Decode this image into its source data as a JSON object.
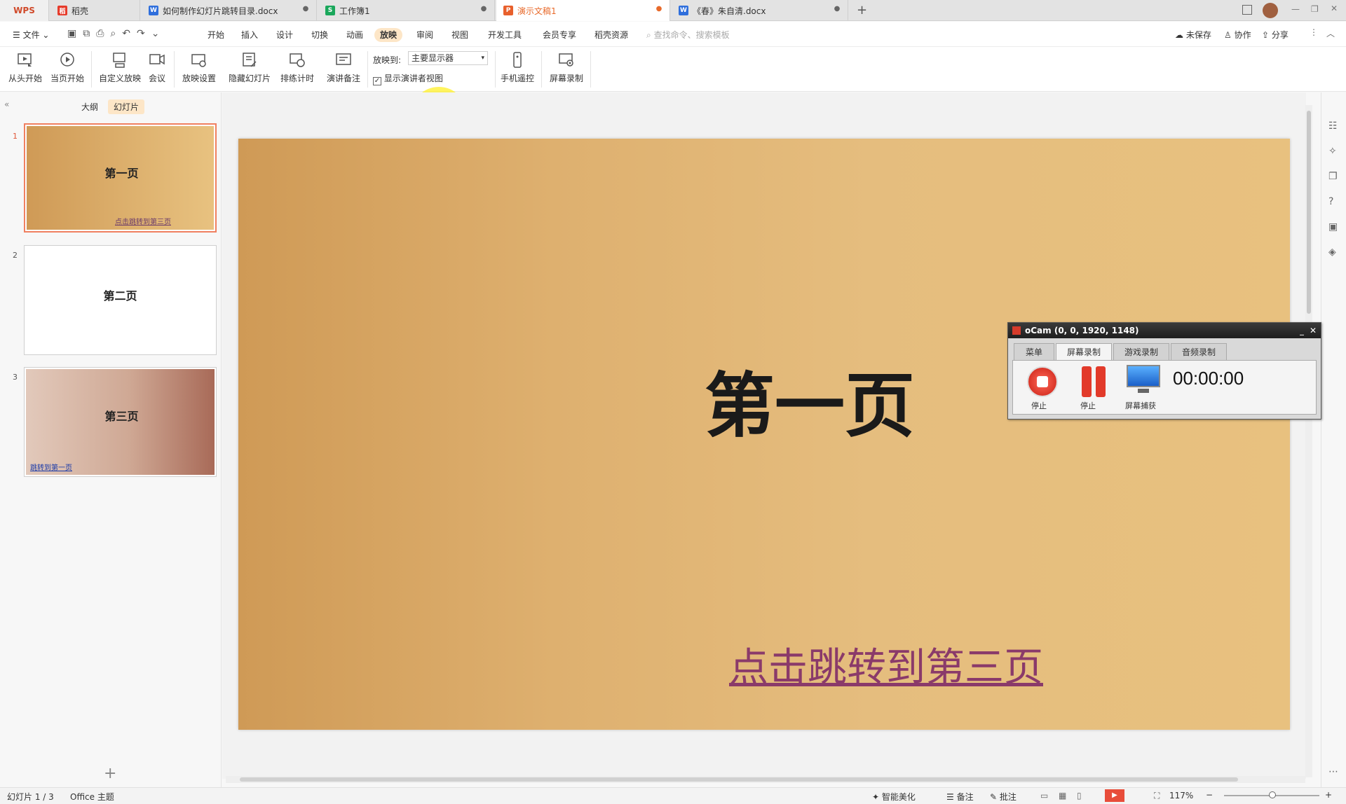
{
  "tabs": [
    {
      "label": "WPS"
    },
    {
      "label": "稻壳"
    },
    {
      "label": "如何制作幻灯片跳转目录.docx"
    },
    {
      "label": "工作簿1"
    },
    {
      "label": "演示文稿1"
    },
    {
      "label": "《春》朱自清.docx"
    }
  ],
  "menu": {
    "file": "文件",
    "items": [
      "开始",
      "插入",
      "设计",
      "切换",
      "动画",
      "放映",
      "审阅",
      "视图",
      "开发工具",
      "会员专享",
      "稻壳资源"
    ],
    "search_placeholder": "查找命令、搜索模板",
    "unsaved": "未保存",
    "collab": "协作",
    "share": "分享"
  },
  "toolbar": {
    "from_start": "从头开始",
    "from_current": "当页开始",
    "custom": "自定义放映",
    "meeting": "会议",
    "settings": "放映设置",
    "hide": "隐藏幻灯片",
    "rehearse": "排练计时",
    "notes": "演讲备注",
    "play_to_label": "放映到:",
    "play_to_value": "主要显示器",
    "presenter_view": "显示演讲者视图",
    "remote": "手机遥控",
    "record": "屏幕录制"
  },
  "panel": {
    "outline": "大纲",
    "slides": "幻灯片"
  },
  "slides": [
    {
      "num": "1",
      "title": "第一页",
      "link": "点击跳转到第三页"
    },
    {
      "num": "2",
      "title": "第二页"
    },
    {
      "num": "3",
      "title": "第三页",
      "link": "跳转到第一页"
    }
  ],
  "main_slide": {
    "title": "第一页",
    "link": "点击跳转到第三页"
  },
  "ocam": {
    "title": "oCam (0, 0, 1920, 1148)",
    "tabs": [
      "菜单",
      "屏幕录制",
      "游戏录制",
      "音频录制"
    ],
    "stop": "停止",
    "pause": "停止",
    "capture": "屏幕捕获",
    "timer": "00:00:00"
  },
  "status": {
    "slide_count": "幻灯片 1 / 3",
    "theme": "Office 主题",
    "beautify": "智能美化",
    "notes": "备注",
    "comments": "批注",
    "zoom": "117%"
  }
}
